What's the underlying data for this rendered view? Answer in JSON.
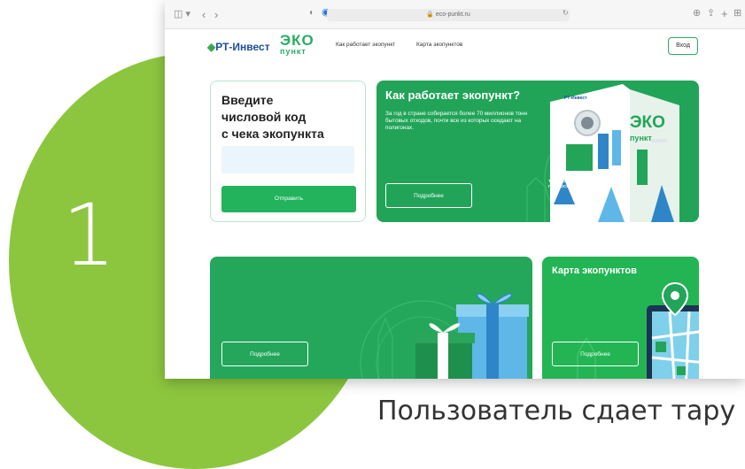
{
  "step": {
    "number": "1"
  },
  "caption": "Пользователь сдает тару",
  "browser": {
    "url": "eco-punkt.ru"
  },
  "site": {
    "logo_rt": "РТ-Инвест",
    "logo_eco": "ЭКО",
    "logo_punkt": "пункт",
    "nav": [
      "Как работает экопункт",
      "Карта экопунктов"
    ],
    "login_label": "Вход"
  },
  "code_card": {
    "title": "Введите\nчисловой код\nс чека экопункта",
    "input_value": "",
    "submit_label": "Отправить"
  },
  "how_card": {
    "title": "Как работает экопункт?",
    "text": "За год в стране собирается более 70 миллионов тонн бытовых отходов, почти все из которых оседают на полигонах.",
    "more_label": "Подробнее",
    "machine": {
      "brand": "РТ-Инвест",
      "eco": "ЭКО",
      "punkt": "пункт",
      "slogan": "ТЫ ДЕЛАЕШЬ ЧИСТЫМ ПОДМОСКОВЬЕ!"
    }
  },
  "gift_card": {
    "more_label": "Подробнее"
  },
  "map_card": {
    "title": "Карта экопунктов",
    "more_label": "Подробнее"
  },
  "colors": {
    "lime": "#8cc63f",
    "brand_green": "#22b35c",
    "brand_blue": "#1b4f9c"
  }
}
